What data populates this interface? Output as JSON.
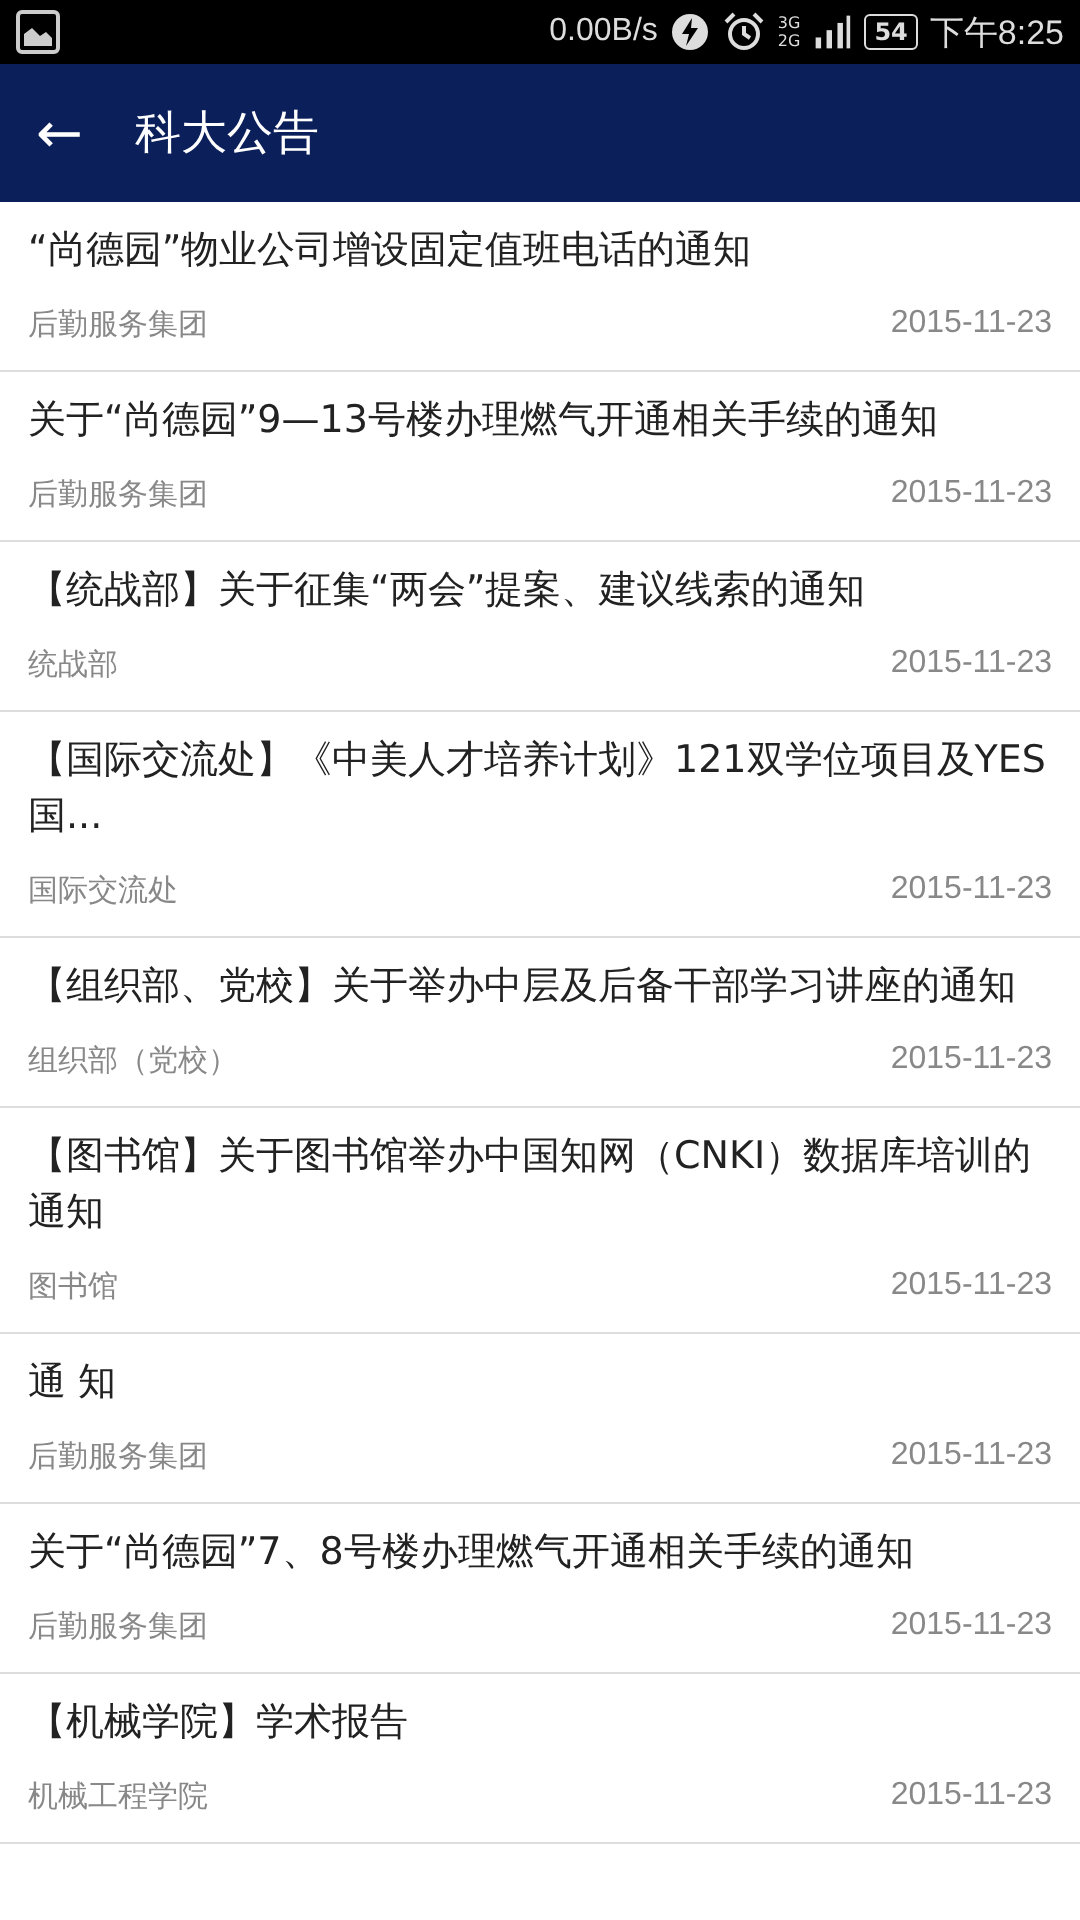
{
  "status_bar": {
    "speed": "0.00B/s",
    "network_top": "3G",
    "network_bottom": "2G",
    "battery": "54",
    "time": "下午8:25"
  },
  "app_bar": {
    "back": "←",
    "title": "科大公告"
  },
  "notices": [
    {
      "title": "“尚德园”物业公司增设固定值班电话的通知",
      "source": "后勤服务集团",
      "date": "2015-11-23"
    },
    {
      "title": "关于“尚德园”9—13号楼办理燃气开通相关手续的通知",
      "source": "后勤服务集团",
      "date": "2015-11-23"
    },
    {
      "title": "【统战部】关于征集“两会”提案、建议线索的通知",
      "source": "统战部",
      "date": "2015-11-23"
    },
    {
      "title": "【国际交流处】《中美人才培养计划》121双学位项目及YES国...",
      "source": "国际交流处",
      "date": "2015-11-23"
    },
    {
      "title": "【组织部、党校】关于举办中层及后备干部学习讲座的通知",
      "source": "组织部（党校）",
      "date": "2015-11-23"
    },
    {
      "title": "【图书馆】关于图书馆举办中国知网（CNKI）数据库培训的通知",
      "source": "图书馆",
      "date": "2015-11-23"
    },
    {
      "title": "通 知",
      "source": "后勤服务集团",
      "date": "2015-11-23"
    },
    {
      "title": "关于“尚德园”7、8号楼办理燃气开通相关手续的通知",
      "source": "后勤服务集团",
      "date": "2015-11-23"
    },
    {
      "title": "【机械学院】学术报告",
      "source": "机械工程学院",
      "date": "2015-11-23"
    }
  ]
}
